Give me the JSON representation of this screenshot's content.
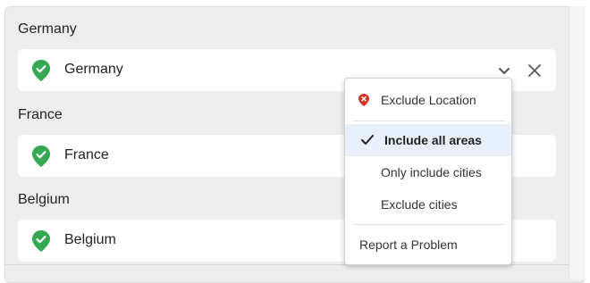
{
  "locations": [
    {
      "section_label": "Germany",
      "value": "Germany"
    },
    {
      "section_label": "France",
      "value": "France"
    },
    {
      "section_label": "Belgium",
      "value": "Belgium"
    }
  ],
  "icons": {
    "location_pin": "location-pin-check-icon",
    "dropdown": "chevron-down-icon",
    "remove": "close-icon",
    "exclude": "location-pin-x-icon",
    "selected": "checkmark-icon"
  },
  "dropdown_menu": {
    "exclude_location": "Exclude Location",
    "options": [
      {
        "label": "Include all areas",
        "selected": true
      },
      {
        "label": "Only include cities",
        "selected": false
      },
      {
        "label": "Exclude cities",
        "selected": false
      }
    ],
    "report": "Report a Problem"
  },
  "colors": {
    "pin_green": "#34a853",
    "exclude_red": "#d93025",
    "selected_bg": "#e8f0fb",
    "panel_bg": "#eeeeee"
  }
}
